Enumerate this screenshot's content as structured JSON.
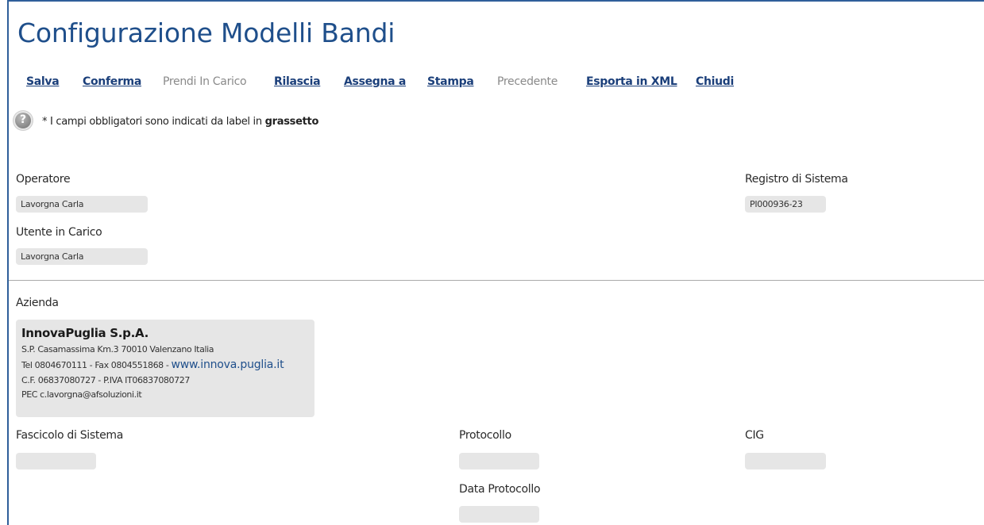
{
  "page": {
    "title": "Configurazione Modelli Bandi"
  },
  "toolbar": {
    "items": [
      {
        "label": "Salva",
        "enabled": true
      },
      {
        "label": "Conferma",
        "enabled": true
      },
      {
        "label": "Prendi In Carico",
        "enabled": false
      },
      {
        "label": "Rilascia",
        "enabled": true
      },
      {
        "label": "Assegna a",
        "enabled": true
      },
      {
        "label": "Stampa",
        "enabled": true
      },
      {
        "label": "Precedente",
        "enabled": false
      },
      {
        "label": "Esporta in XML",
        "enabled": true
      },
      {
        "label": "Chiudi",
        "enabled": true
      }
    ]
  },
  "help": {
    "icon": "help-question-icon",
    "text_prefix": "* I campi obbligatori sono indicati da label in",
    "text_bold": "grassetto"
  },
  "form": {
    "operatore": {
      "label": "Operatore",
      "value": "Lavorgna Carla"
    },
    "registro": {
      "label": "Registro di Sistema",
      "value": "PI000936-23"
    },
    "utente_in_carico": {
      "label": "Utente in Carico",
      "value": "Lavorgna Carla"
    },
    "azienda": {
      "label": "Azienda",
      "name": "InnovaPuglia S.p.A.",
      "address": "S.P. Casamassima Km.3 70010 Valenzano Italia",
      "phone_fax": "Tel 0804670111 - Fax 0804551868 -",
      "website": "www.innova.puglia.it",
      "tax": "C.F. 06837080727 - P.IVA IT06837080727",
      "pec": "PEC c.lavorgna@afsoluzioni.it"
    },
    "fascicolo": {
      "label": "Fascicolo di Sistema",
      "value": ""
    },
    "protocollo": {
      "label": "Protocollo",
      "value": ""
    },
    "cig": {
      "label": "CIG",
      "value": ""
    },
    "data_protocollo": {
      "label": "Data Protocollo",
      "value": ""
    }
  }
}
